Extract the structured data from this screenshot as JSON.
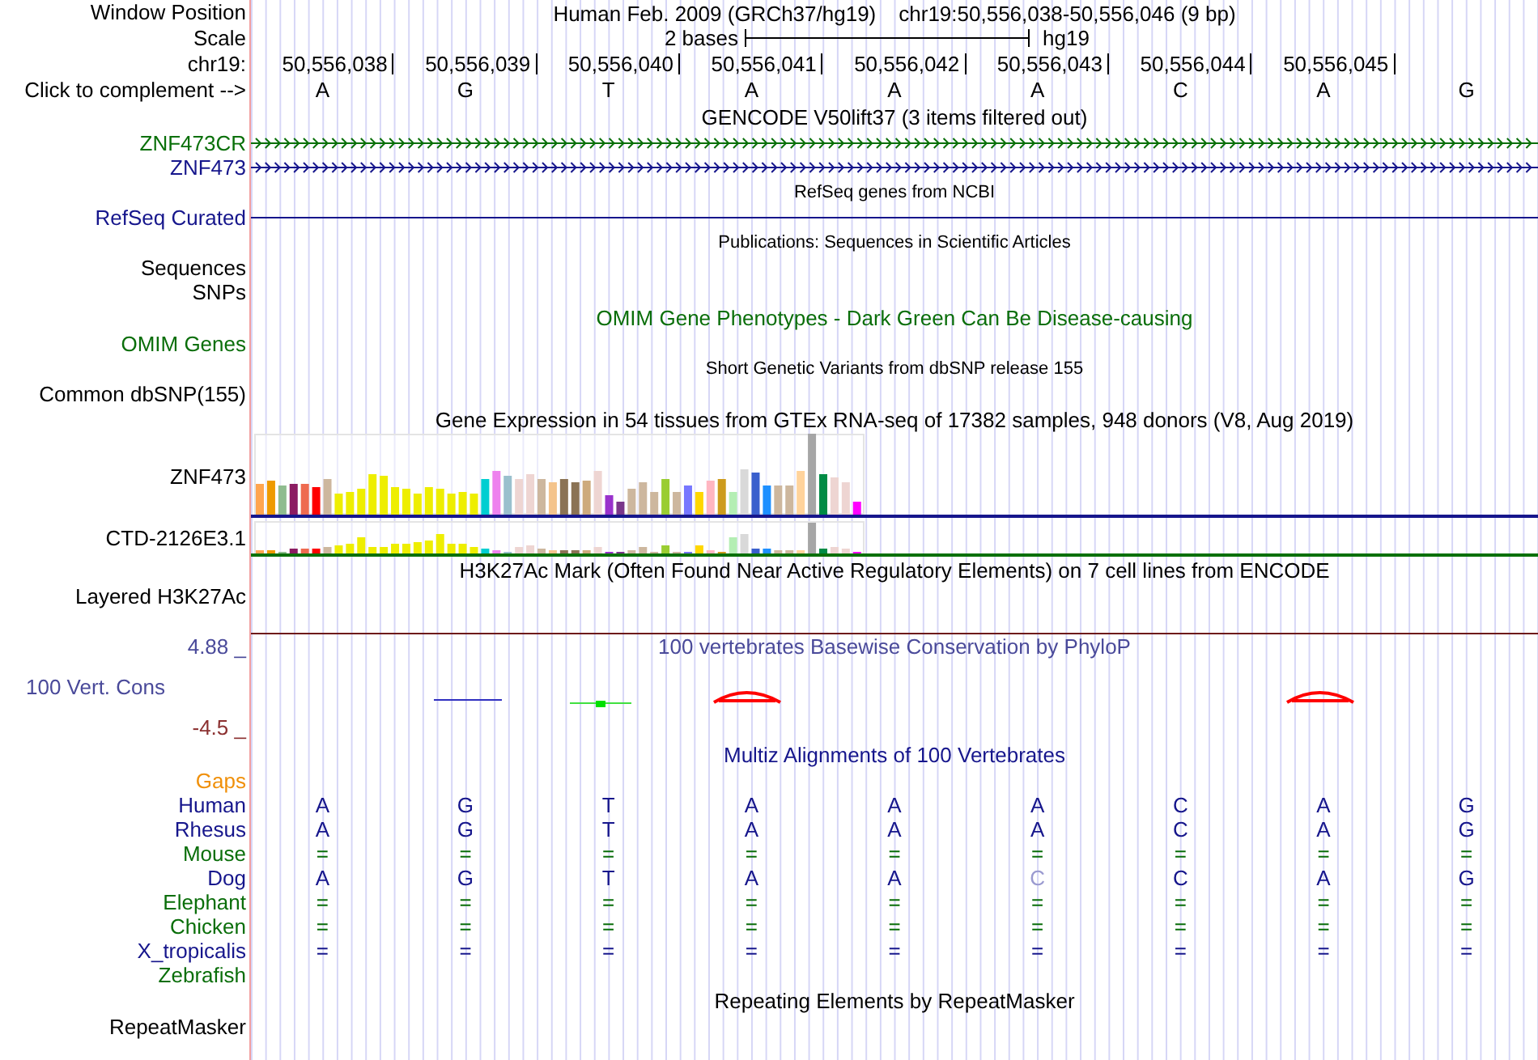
{
  "header": {
    "label": "Window Position",
    "assembly_text": "Human Feb. 2009 (GRCh37/hg19)",
    "range_text": "chr19:50,556,038-50,556,046 (9 bp)"
  },
  "scale": {
    "label": "Scale",
    "length": "2 bases",
    "assembly": "hg19"
  },
  "ruler": {
    "label": "chr19:",
    "positions": [
      "50,556,038",
      "50,556,039",
      "50,556,040",
      "50,556,041",
      "50,556,042",
      "50,556,043",
      "50,556,044",
      "50,556,045"
    ]
  },
  "complement": {
    "label": "Click to complement -->",
    "bases": [
      "A",
      "G",
      "T",
      "A",
      "A",
      "A",
      "C",
      "A",
      "G"
    ]
  },
  "tracks": [
    {
      "kind": "title",
      "text": "GENCODE V50lift37 (3 items filtered out)",
      "small": false,
      "color": "#000000"
    },
    {
      "kind": "gene",
      "label": "ZNF473CR",
      "color": "#0a700a"
    },
    {
      "kind": "gene",
      "label": "ZNF473",
      "color": "#16168c"
    },
    {
      "kind": "title",
      "text": "RefSeq genes from NCBI",
      "small": true,
      "color": "#000000"
    },
    {
      "kind": "line",
      "label": "RefSeq Curated",
      "color": "#16168c"
    },
    {
      "kind": "title",
      "text": "Publications: Sequences in Scientific Articles",
      "small": true,
      "color": "#000000"
    },
    {
      "kind": "label",
      "label": "Sequences",
      "color": "#000000"
    },
    {
      "kind": "label",
      "label": "SNPs",
      "color": "#000000"
    },
    {
      "kind": "title",
      "text": "OMIM Gene Phenotypes - Dark Green Can Be Disease-causing",
      "small": false,
      "color": "#0a6e0a"
    },
    {
      "kind": "label",
      "label": "OMIM Genes",
      "color": "#0a6e0a"
    },
    {
      "kind": "title",
      "text": "Short Genetic Variants from dbSNP release 155",
      "small": true,
      "color": "#000000"
    },
    {
      "kind": "label",
      "label": "Common dbSNP(155)",
      "color": "#000000"
    },
    {
      "kind": "title",
      "text": "Gene Expression in 54 tissues from GTEx RNA-seq of 17382 samples, 948 donors (V8, Aug 2019)",
      "small": false,
      "color": "#000000"
    },
    {
      "kind": "expression",
      "label": "ZNF473",
      "color": "#16168c"
    },
    {
      "kind": "expression",
      "label": "CTD-2126E3.1",
      "color": "#0a700a"
    },
    {
      "kind": "title",
      "text": "H3K27Ac Mark (Often Found Near Active Regulatory Elements) on 7 cell lines from ENCODE",
      "small": false,
      "color": "#000000"
    },
    {
      "kind": "signal",
      "label": "Layered H3K27Ac",
      "color": "#6e1a1a"
    },
    {
      "kind": "conservation",
      "label": "100 Vert. Cons",
      "max": "4.88 _",
      "min": "-4.5 _",
      "title": "100 vertebrates Basewise Conservation by PhyloP",
      "color": "#4a4a9a"
    },
    {
      "kind": "title",
      "text": "Multiz Alignments of 100 Vertebrates",
      "small": false,
      "color": "#16168c"
    },
    {
      "kind": "species",
      "label": "Gaps",
      "color": "#f0900a"
    },
    {
      "kind": "species",
      "label": "Human",
      "color": "#16168c",
      "bases": [
        "A",
        "G",
        "T",
        "A",
        "A",
        "A",
        "C",
        "A",
        "G"
      ]
    },
    {
      "kind": "species",
      "label": "Rhesus",
      "color": "#16168c",
      "bases": [
        "A",
        "G",
        "T",
        "A",
        "A",
        "A",
        "C",
        "A",
        "G"
      ]
    },
    {
      "kind": "species",
      "label": "Mouse",
      "color": "#0a6e0a",
      "bases": [
        "=",
        "=",
        "=",
        "=",
        "=",
        "=",
        "=",
        "=",
        "="
      ]
    },
    {
      "kind": "species",
      "label": "Dog",
      "color": "#16168c",
      "bases": [
        "A",
        "G",
        "T",
        "A",
        "A",
        "C",
        "C",
        "A",
        "G"
      ],
      "faded": [
        false,
        false,
        false,
        false,
        false,
        true,
        false,
        false,
        false
      ]
    },
    {
      "kind": "species",
      "label": "Elephant",
      "color": "#0a6e0a",
      "bases": [
        "=",
        "=",
        "=",
        "=",
        "=",
        "=",
        "=",
        "=",
        "="
      ]
    },
    {
      "kind": "species",
      "label": "Chicken",
      "color": "#0a6e0a",
      "bases": [
        "=",
        "=",
        "=",
        "=",
        "=",
        "=",
        "=",
        "=",
        "="
      ]
    },
    {
      "kind": "species",
      "label": "X_tropicalis",
      "color": "#16168c",
      "bases": [
        "=",
        "=",
        "=",
        "=",
        "=",
        "=",
        "=",
        "=",
        "="
      ]
    },
    {
      "kind": "species",
      "label": "Zebrafish",
      "color": "#0a6e0a"
    },
    {
      "kind": "title",
      "text": "Repeating Elements by RepeatMasker",
      "small": false,
      "color": "#000000"
    },
    {
      "kind": "label",
      "label": "RepeatMasker",
      "color": "#000000"
    }
  ]
}
